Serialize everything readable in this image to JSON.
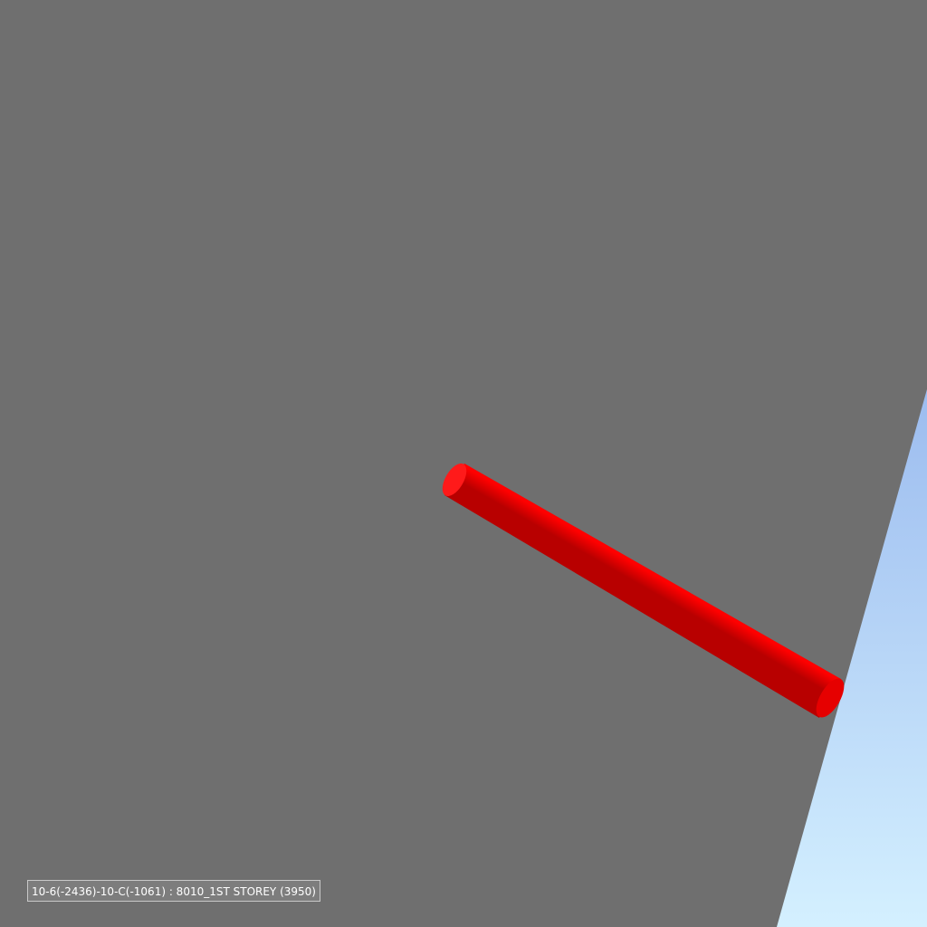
{
  "viewer": {
    "status_label": "10-6(-2436)-10-C(-1061) : 8010_1ST STOREY (3950)"
  },
  "colors": {
    "ground": "#6f6f6f",
    "sky_top": "#9cbcef",
    "sky_bottom": "#d4f0ff",
    "pipe": "#ff0000",
    "pipe_shadow": "#c20000"
  },
  "scene": {
    "objects": [
      {
        "name": "selected-pipe",
        "kind": "cylinder",
        "highlighted": true
      }
    ]
  }
}
